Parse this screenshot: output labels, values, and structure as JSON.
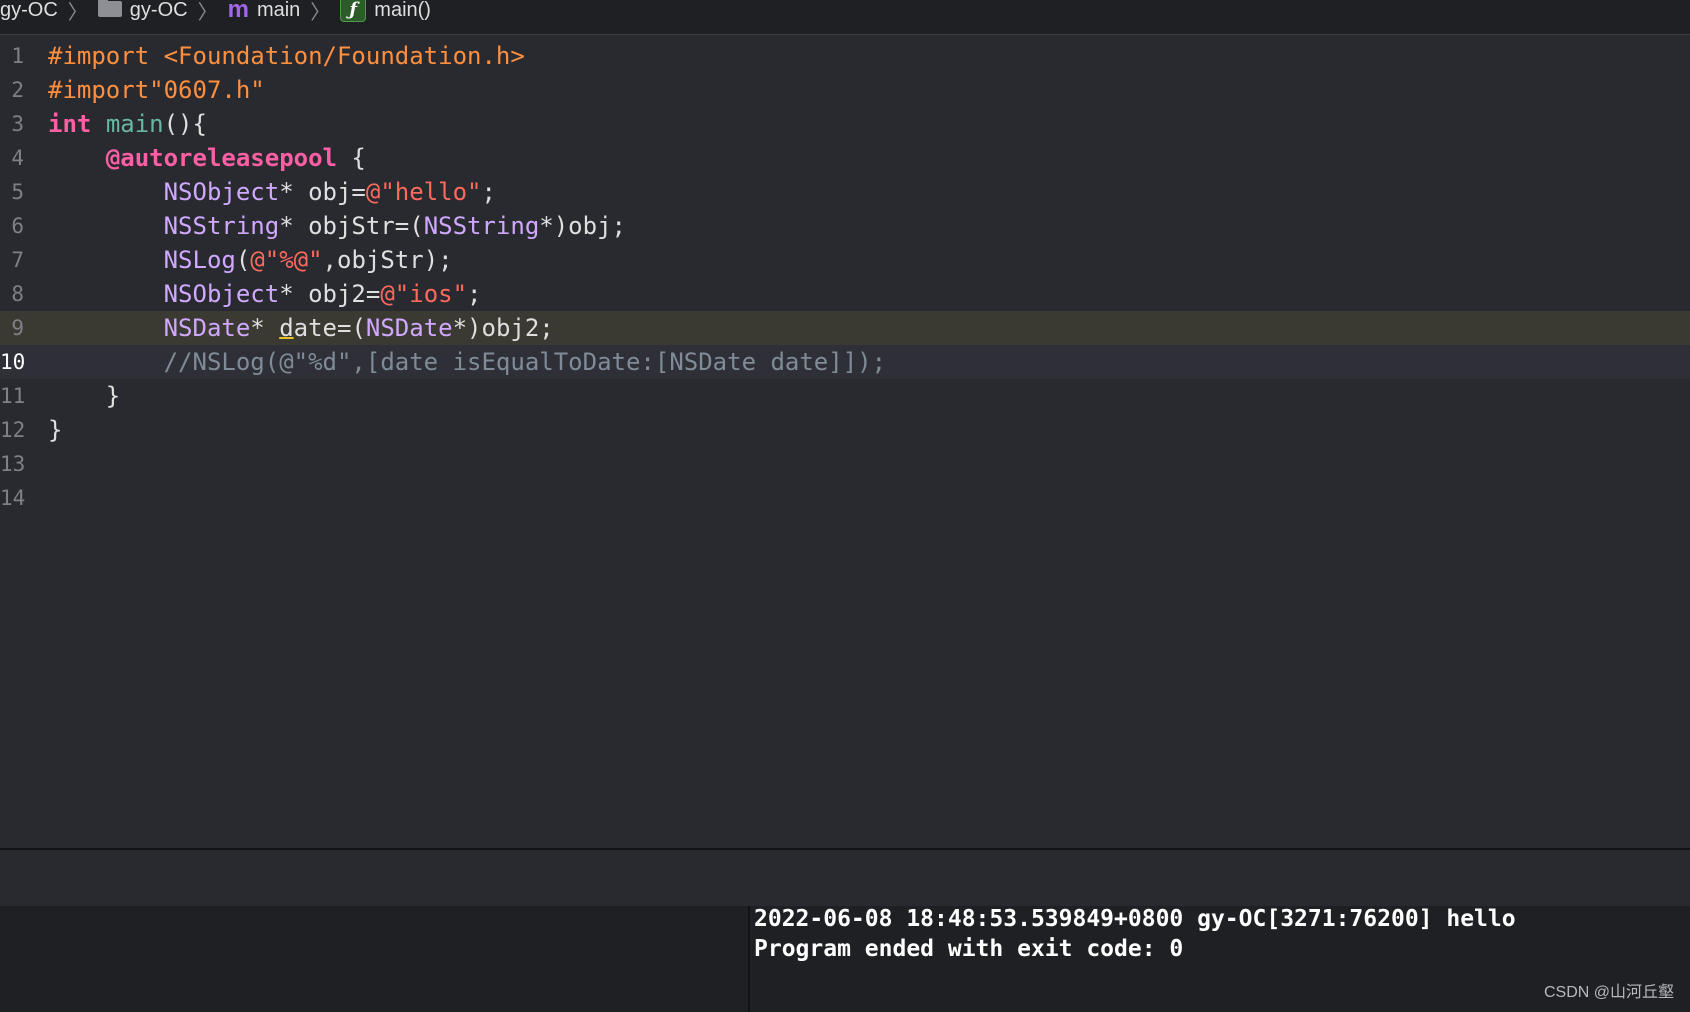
{
  "breadcrumb": {
    "project": "gy-OC",
    "group": "gy-OC",
    "file": "main",
    "function": "main()",
    "file_icon_glyph": "m",
    "function_icon_glyph": "ƒ",
    "icons": [
      "folder-icon",
      "objc-file-icon",
      "function-icon"
    ]
  },
  "editor": {
    "line_numbers": [
      "1",
      "2",
      "3",
      "4",
      "5",
      "6",
      "7",
      "8",
      "9",
      "10",
      "11",
      "12",
      "13",
      "14"
    ],
    "lines": [
      {
        "tokens": [
          {
            "t": "#import ",
            "c": "kw-pre"
          },
          {
            "t": "<Foundation/Foundation.h>",
            "c": "str-inc"
          }
        ]
      },
      {
        "tokens": [
          {
            "t": "#import",
            "c": "kw-pre"
          },
          {
            "t": "\"0607.h\"",
            "c": "str-inc"
          }
        ]
      },
      {
        "tokens": [
          {
            "t": "int",
            "c": "kw"
          },
          {
            "t": " ",
            "c": "plain"
          },
          {
            "t": "main",
            "c": "fn"
          },
          {
            "t": "(){",
            "c": "plain"
          }
        ]
      },
      {
        "tokens": [
          {
            "t": "    ",
            "c": "plain"
          },
          {
            "t": "@autoreleasepool",
            "c": "kw"
          },
          {
            "t": " {",
            "c": "plain"
          }
        ]
      },
      {
        "tokens": [
          {
            "t": "        ",
            "c": "plain"
          },
          {
            "t": "NSObject",
            "c": "cls"
          },
          {
            "t": "* obj=",
            "c": "plain"
          },
          {
            "t": "@\"hello\"",
            "c": "str"
          },
          {
            "t": ";",
            "c": "plain"
          }
        ]
      },
      {
        "tokens": [
          {
            "t": "        ",
            "c": "plain"
          },
          {
            "t": "NSString",
            "c": "cls"
          },
          {
            "t": "* objStr=(",
            "c": "plain"
          },
          {
            "t": "NSString",
            "c": "cls"
          },
          {
            "t": "*)obj;",
            "c": "plain"
          }
        ]
      },
      {
        "tokens": [
          {
            "t": "        ",
            "c": "plain"
          },
          {
            "t": "NSLog",
            "c": "cls"
          },
          {
            "t": "(",
            "c": "plain"
          },
          {
            "t": "@\"%@\"",
            "c": "str"
          },
          {
            "t": ",objStr);",
            "c": "plain"
          }
        ]
      },
      {
        "tokens": [
          {
            "t": "        ",
            "c": "plain"
          },
          {
            "t": "NSObject",
            "c": "cls"
          },
          {
            "t": "* obj2=",
            "c": "plain"
          },
          {
            "t": "@\"ios\"",
            "c": "str"
          },
          {
            "t": ";",
            "c": "plain"
          }
        ]
      },
      {
        "tokens": [
          {
            "t": "        ",
            "c": "plain"
          },
          {
            "t": "NSDate",
            "c": "cls"
          },
          {
            "t": "* ",
            "c": "plain"
          },
          {
            "t": "d",
            "c": "plain warn-under"
          },
          {
            "t": "ate=(",
            "c": "plain"
          },
          {
            "t": "NSDate",
            "c": "cls"
          },
          {
            "t": "*)obj2;",
            "c": "plain"
          }
        ]
      },
      {
        "tokens": [
          {
            "t": "        ",
            "c": "plain"
          },
          {
            "t": "//NSLog(@\"%d\",[date isEqualToDate:[NSDate date]]);",
            "c": "cmt"
          }
        ]
      },
      {
        "tokens": [
          {
            "t": "    }",
            "c": "plain"
          }
        ]
      },
      {
        "tokens": [
          {
            "t": "}",
            "c": "plain"
          }
        ]
      },
      {
        "tokens": []
      },
      {
        "tokens": []
      }
    ],
    "highlighted_line": 9,
    "current_line": 10
  },
  "console": {
    "lines": [
      "2022-06-08 18:48:53.539849+0800 gy-OC[3271:76200] hello",
      "Program ended with exit code: 0"
    ]
  },
  "watermark": "CSDN @山河丘壑"
}
